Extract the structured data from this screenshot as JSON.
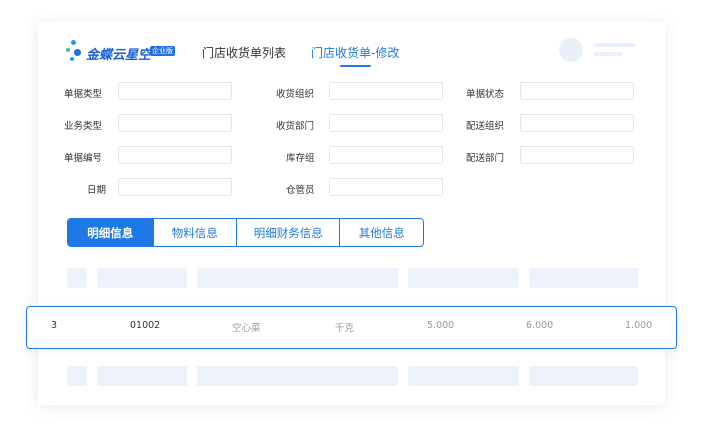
{
  "logo": {
    "brand": "金蝶云星空",
    "edition": "企业版"
  },
  "nav": {
    "tab_list": "门店收货单列表",
    "tab_edit": "门店收货单-修改"
  },
  "form": {
    "col1": [
      "单据类型",
      "业务类型",
      "单据编号",
      "日期"
    ],
    "col2": [
      "收货组织",
      "收货部门",
      "库存组",
      "仓管员"
    ],
    "col3": [
      "单据状态",
      "配送组织",
      "配送部门"
    ]
  },
  "tabs": [
    "明细信息",
    "物料信息",
    "明细财务信息",
    "其他信息"
  ],
  "row": {
    "seq": "3",
    "code": "01002",
    "name": "空心菜",
    "unit": "千克",
    "v1": "5.000",
    "v2": "6.000",
    "v3": "1.000"
  },
  "colors": {
    "accent": "#1e78e6",
    "placeholder": "#eef2fa"
  }
}
